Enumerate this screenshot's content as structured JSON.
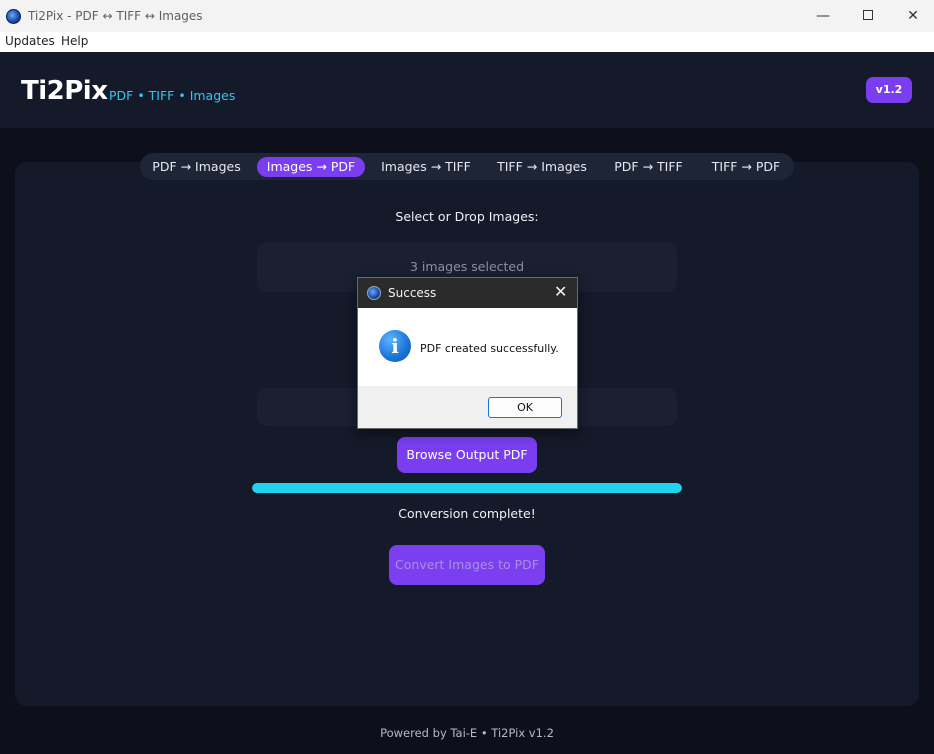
{
  "window": {
    "title": "Ti2Pix - PDF ↔ TIFF ↔ Images"
  },
  "menu": [
    "Updates",
    "Help"
  ],
  "header": {
    "brand": "Ti2Pix",
    "subtitle": "PDF  •  TIFF  •  Images",
    "version": "v1.2"
  },
  "tabs": [
    {
      "label": "PDF → Images",
      "active": false
    },
    {
      "label": "Images → PDF",
      "active": true
    },
    {
      "label": "Images → TIFF",
      "active": false
    },
    {
      "label": "TIFF → Images",
      "active": false
    },
    {
      "label": "PDF → TIFF",
      "active": false
    },
    {
      "label": "TIFF → PDF",
      "active": false
    }
  ],
  "main": {
    "select_label": "Select or Drop Images:",
    "images_field": "3 images selected",
    "output_field": "",
    "browse_output_label": "Browse Output PDF",
    "progress": 1.0,
    "status": "Conversion complete!",
    "convert_label": "Convert Images to PDF"
  },
  "dialog": {
    "title": "Success",
    "message": "PDF created successfully.",
    "ok_label": "OK",
    "icon": "info-icon"
  },
  "footer": "Powered by Tai-E  •  Ti2Pix v1.2",
  "colors": {
    "accent": "#7a3ef0",
    "progress": "#22d3ee",
    "background": "#0d0f1a",
    "card": "#141a2a",
    "subtitle": "#33c6f0"
  }
}
